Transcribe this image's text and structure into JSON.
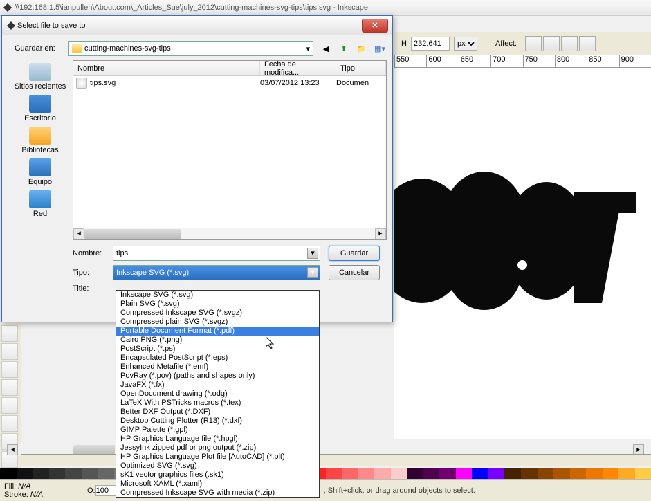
{
  "titlebar": "\\\\192.168.1.5\\ianpullen\\About.com\\_Articles_Sue\\july_2012\\cutting-machines-svg-tips\\tips.svg - Inkscape",
  "dialog": {
    "title": "Select file to save to",
    "save_in_label": "Guardar en:",
    "save_in_value": "cutting-machines-svg-tips",
    "sidebar": [
      {
        "label": "Sitios recientes",
        "class": "ic-recent"
      },
      {
        "label": "Escritorio",
        "class": "ic-desktop"
      },
      {
        "label": "Bibliotecas",
        "class": "ic-lib"
      },
      {
        "label": "Equipo",
        "class": "ic-pc"
      },
      {
        "label": "Red",
        "class": "ic-net"
      }
    ],
    "columns": {
      "name": "Nombre",
      "date": "Fecha de modifica...",
      "type": "Tipo"
    },
    "file": {
      "name": "tips.svg",
      "date": "03/07/2012 13:23",
      "type": "Documen"
    },
    "name_label": "Nombre:",
    "name_value": "tips",
    "type_label": "Tipo:",
    "type_value": "Inkscape SVG (*.svg)",
    "title_label": "Title:",
    "save_btn": "Guardar",
    "cancel_btn": "Cancelar"
  },
  "format_options": [
    "Inkscape SVG (*.svg)",
    "Plain SVG (*.svg)",
    "Compressed Inkscape SVG (*.svgz)",
    "Compressed plain SVG (*.svgz)",
    "Portable Document Format (*.pdf)",
    "Cairo PNG (*.png)",
    "PostScript (*.ps)",
    "Encapsulated PostScript (*.eps)",
    "Enhanced Metafile (*.emf)",
    "PovRay (*.pov) (paths and shapes only)",
    "JavaFX (*.fx)",
    "OpenDocument drawing (*.odg)",
    "LaTeX With PSTricks macros (*.tex)",
    "Better DXF Output (*.DXF)",
    "Desktop Cutting Plotter (R13) (*.dxf)",
    "GIMP Palette (*.gpl)",
    "HP Graphics Language file (*.hpgl)",
    "JessyInk zipped pdf or png output (*.zip)",
    "HP Graphics Language Plot file [AutoCAD] (*.plt)",
    "Optimized SVG (*.svg)",
    "sK1 vector graphics files (.sk1)",
    "Microsoft XAML (*.xaml)",
    "Compressed Inkscape SVG with media (*.zip)"
  ],
  "highlighted_option_index": 4,
  "toolbar": {
    "h_label": "H",
    "h_value": "232.641",
    "unit": "px",
    "affect_label": "Affect:"
  },
  "ruler_ticks": [
    "550",
    "600",
    "650",
    "700",
    "750",
    "800",
    "850",
    "900"
  ],
  "status": {
    "fill_label": "Fill:",
    "fill_value": "N/A",
    "stroke_label": "Stroke:",
    "stroke_value": "N/A",
    "o_label": "O:",
    "o_value": "100",
    "hint": ", Shift+click, or drag around objects to select."
  },
  "swatch_colors": [
    "#000",
    "#111",
    "#222",
    "#333",
    "#444",
    "#555",
    "#666",
    "#777",
    "#888",
    "#999",
    "#aaa",
    "#fff",
    "#400",
    "#600",
    "#800",
    "#a00",
    "#c00",
    "#e00",
    "#f00",
    "#f22",
    "#f44",
    "#f66",
    "#f88",
    "#faa",
    "#fcc",
    "#300030",
    "#500050",
    "#700070",
    "#f0f",
    "#00f",
    "#7700ff",
    "#420",
    "#630",
    "#840",
    "#a50",
    "#c60",
    "#e70",
    "#f80",
    "#fa2",
    "#fc4"
  ]
}
